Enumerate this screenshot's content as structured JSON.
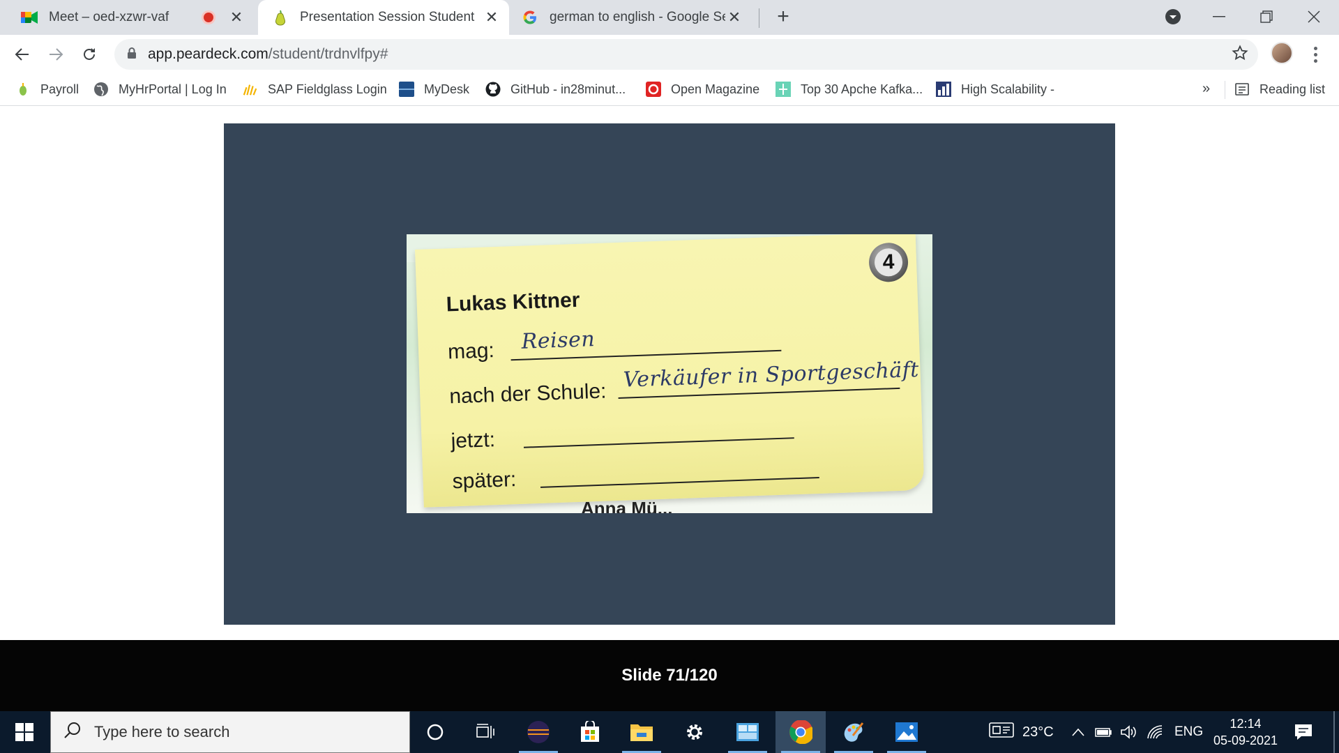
{
  "browser": {
    "tabs": [
      {
        "title": "Meet – oed-xzwr-vaf",
        "icon": "google-meet-icon",
        "recording": true
      },
      {
        "title": "Presentation Session Student",
        "icon": "pear-deck-icon",
        "active": true
      },
      {
        "title": "german to english - Google Sear",
        "icon": "google-icon"
      }
    ],
    "url_domain": "app.peardeck.com",
    "url_path": "/student/trdnvlfpy#",
    "bookmarks": [
      {
        "label": "Payroll",
        "icon": "payroll-icon"
      },
      {
        "label": "MyHrPortal | Log In",
        "icon": "globe-icon"
      },
      {
        "label": "SAP Fieldglass Login",
        "icon": "sap-fieldglass-icon"
      },
      {
        "label": "MyDesk",
        "icon": "mydesk-icon"
      },
      {
        "label": "GitHub - in28minut...",
        "icon": "github-icon"
      },
      {
        "label": "Open Magazine",
        "icon": "open-magazine-icon"
      },
      {
        "label": "Top 30 Apche Kafka...",
        "icon": "kafka-icon"
      },
      {
        "label": "High Scalability -",
        "icon": "high-scalability-icon"
      }
    ],
    "bookmarks_overflow": "»",
    "reading_list": "Reading list"
  },
  "slide": {
    "note": {
      "badge": "4",
      "name": "Lukas Kittner",
      "fields": [
        {
          "label": "mag:",
          "value": "Reisen"
        },
        {
          "label": "nach der Schule:",
          "value": "Verkäufer in Sportgeschäft"
        },
        {
          "label": "jetzt:",
          "value": ""
        },
        {
          "label": "später:",
          "value": ""
        }
      ],
      "next_name_peek": "Anna Mü..."
    },
    "counter": "Slide 71/120"
  },
  "taskbar": {
    "search_placeholder": "Type here to search",
    "weather": "23°C",
    "language": "ENG",
    "time": "12:14",
    "date": "05-09-2021",
    "colors": {
      "taskbar": "#0b1a2c",
      "slide_bg": "#354557",
      "note": "#f6f2a6"
    }
  }
}
